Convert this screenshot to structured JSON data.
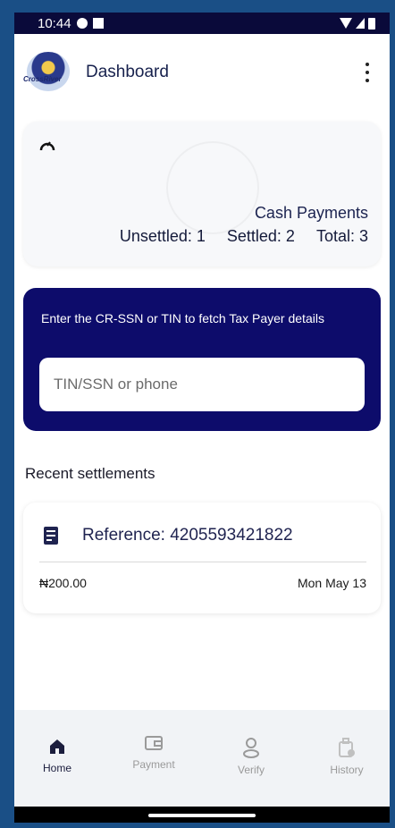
{
  "status": {
    "time": "10:44"
  },
  "header": {
    "title": "Dashboard",
    "logo_text": "CrossRiver"
  },
  "summary": {
    "title": "Cash Payments",
    "unsettled": "Unsettled: 1",
    "settled": "Settled: 2",
    "total": "Total: 3"
  },
  "fetch": {
    "instruction": "Enter the CR-SSN or TIN to fetch Tax Payer details",
    "placeholder": "TIN/SSN or phone"
  },
  "recent": {
    "title": "Recent settlements",
    "items": [
      {
        "reference": "Reference: 4205593421822",
        "amount": "₦200.00",
        "date": "Mon May 13"
      }
    ]
  },
  "nav": {
    "items": [
      {
        "label": "Home",
        "icon": "home-icon",
        "active": true
      },
      {
        "label": "Payment",
        "icon": "wallet-icon",
        "active": false
      },
      {
        "label": "Verify",
        "icon": "person-icon",
        "active": false
      },
      {
        "label": "History",
        "icon": "history-icon",
        "active": false
      }
    ]
  },
  "colors": {
    "primary": "#0d0c6b",
    "frame": "#1a4f86"
  }
}
